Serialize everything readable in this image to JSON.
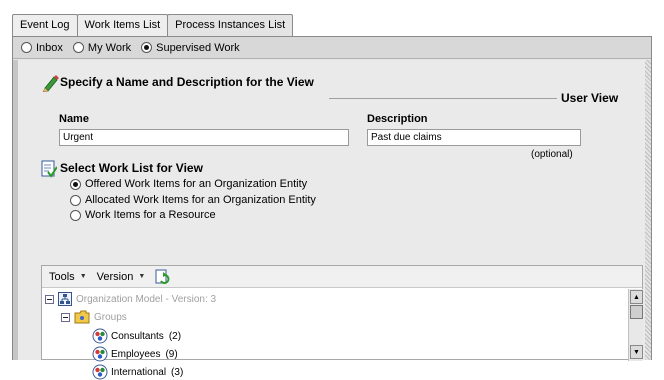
{
  "tabs": [
    "Event Log",
    "Work Items List",
    "Process Instances List"
  ],
  "view_filter": {
    "options": [
      "Inbox",
      "My Work",
      "Supervised Work"
    ],
    "selected": "Supervised Work"
  },
  "view_spec": {
    "heading": "Specify a Name and Description for the View",
    "section_label": "User View",
    "name_label": "Name",
    "name_value": "Urgent",
    "description_label": "Description",
    "description_value": "Past due claims",
    "optional_note": "(optional)"
  },
  "worklist": {
    "heading": "Select Work List for View",
    "options": [
      "Offered Work Items for an Organization Entity",
      "Allocated Work Items for an Organization Entity",
      "Work Items for a Resource"
    ],
    "selected": "Offered Work Items for an Organization Entity"
  },
  "toolbar": {
    "tools_label": "Tools",
    "version_label": "Version",
    "refresh_icon": "refresh-icon"
  },
  "tree": {
    "root": "Organization Model - Version: 3",
    "groups_label": "Groups",
    "groups": [
      {
        "name": "Consultants",
        "count": "(2)"
      },
      {
        "name": "Employees",
        "count": "(9)"
      },
      {
        "name": "International",
        "count": "(3)"
      }
    ]
  },
  "icons": {
    "edit": "pencil-icon",
    "worklist": "checklist-icon",
    "model": "org-model-icon",
    "folder": "folder-icon",
    "group": "group-icon"
  },
  "colors": {
    "panel_bg": "#eaeaea",
    "radio_bar_bg": "#d8d8d8",
    "muted_text": "#a0a0a0"
  }
}
